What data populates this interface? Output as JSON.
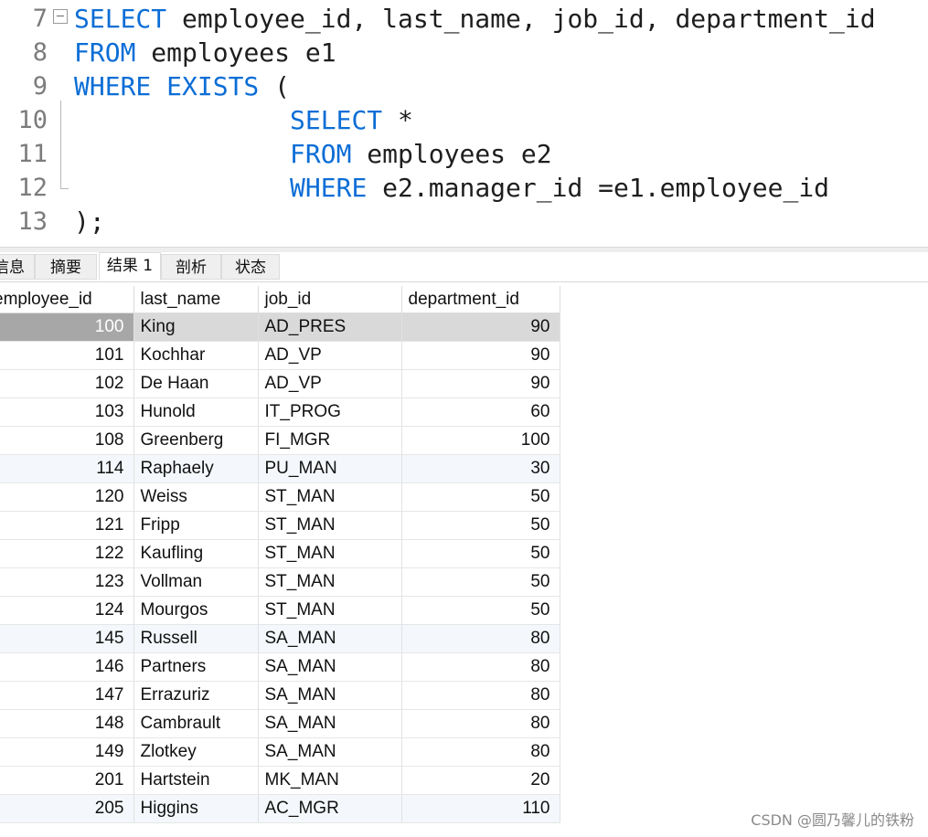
{
  "editor": {
    "lines": [
      {
        "number": "7",
        "tokens": [
          {
            "text": "SELECT",
            "kw": true
          },
          {
            "text": " employee_id, last_name, job_id, department_id",
            "kw": false
          }
        ]
      },
      {
        "number": "8",
        "tokens": [
          {
            "text": "FROM",
            "kw": true
          },
          {
            "text": " employees e1",
            "kw": false
          }
        ]
      },
      {
        "number": "9",
        "tokens": [
          {
            "text": "WHERE EXISTS",
            "kw": true
          },
          {
            "text": " (",
            "kw": false
          }
        ]
      },
      {
        "number": "10",
        "tokens": [
          {
            "text": "              ",
            "kw": false
          },
          {
            "text": "SELECT",
            "kw": true
          },
          {
            "text": " *",
            "kw": false
          }
        ]
      },
      {
        "number": "11",
        "tokens": [
          {
            "text": "              ",
            "kw": false
          },
          {
            "text": "FROM",
            "kw": true
          },
          {
            "text": " employees e2",
            "kw": false
          }
        ]
      },
      {
        "number": "12",
        "tokens": [
          {
            "text": "              ",
            "kw": false
          },
          {
            "text": "WHERE",
            "kw": true
          },
          {
            "text": " e2.manager_id =e1.employee_id",
            "kw": false
          }
        ]
      },
      {
        "number": "13",
        "tokens": [
          {
            "text": ");",
            "kw": false
          }
        ]
      }
    ]
  },
  "tabs": [
    {
      "label": "信息",
      "active": false
    },
    {
      "label": "摘要",
      "active": false
    },
    {
      "label": "结果 1",
      "active": true
    },
    {
      "label": "剖析",
      "active": false
    },
    {
      "label": "状态",
      "active": false
    }
  ],
  "grid": {
    "columns": [
      "employee_id",
      "last_name",
      "job_id",
      "department_id"
    ],
    "rows": [
      [
        "100",
        "King",
        "AD_PRES",
        "90"
      ],
      [
        "101",
        "Kochhar",
        "AD_VP",
        "90"
      ],
      [
        "102",
        "De Haan",
        "AD_VP",
        "90"
      ],
      [
        "103",
        "Hunold",
        "IT_PROG",
        "60"
      ],
      [
        "108",
        "Greenberg",
        "FI_MGR",
        "100"
      ],
      [
        "114",
        "Raphaely",
        "PU_MAN",
        "30"
      ],
      [
        "120",
        "Weiss",
        "ST_MAN",
        "50"
      ],
      [
        "121",
        "Fripp",
        "ST_MAN",
        "50"
      ],
      [
        "122",
        "Kaufling",
        "ST_MAN",
        "50"
      ],
      [
        "123",
        "Vollman",
        "ST_MAN",
        "50"
      ],
      [
        "124",
        "Mourgos",
        "ST_MAN",
        "50"
      ],
      [
        "145",
        "Russell",
        "SA_MAN",
        "80"
      ],
      [
        "146",
        "Partners",
        "SA_MAN",
        "80"
      ],
      [
        "147",
        "Errazuriz",
        "SA_MAN",
        "80"
      ],
      [
        "148",
        "Cambrault",
        "SA_MAN",
        "80"
      ],
      [
        "149",
        "Zlotkey",
        "SA_MAN",
        "80"
      ],
      [
        "201",
        "Hartstein",
        "MK_MAN",
        "20"
      ],
      [
        "205",
        "Higgins",
        "AC_MGR",
        "110"
      ]
    ],
    "selected_row": 0
  },
  "watermark": "CSDN @圆乃馨儿的铁粉",
  "colors": {
    "keyword": "#0b6dd6",
    "selected_row": "#d9d9d9",
    "alt_row": "#f4f8fc"
  }
}
